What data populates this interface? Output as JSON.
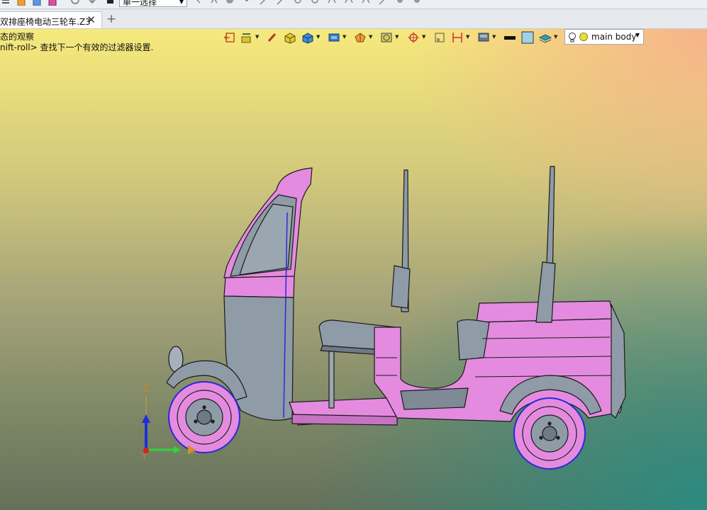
{
  "toolbar": {
    "selection_filter": "单一选择",
    "icons": [
      "menu-icon",
      "open-icon",
      "save-icon",
      "save-as-icon",
      "undo-icon",
      "redo-icon",
      "pick-point-icon",
      "line-icon",
      "circle-icon",
      "curve-icon"
    ]
  },
  "tabs": {
    "doc_title": "双排座椅电动三轮车.Z3",
    "close_glyph": "✕",
    "new_glyph": "+"
  },
  "messages": {
    "line1": "态的观察",
    "line2": "nift-roll> 查找下一个有效的过滤器设置."
  },
  "view_toolbar": {
    "layer_name": "main body",
    "buttons": [
      "exit-view-icon",
      "wireframe-icon",
      "pen-icon",
      "shaded-icon",
      "cube-view-icon",
      "view-cube-icon",
      "render-mode-icon",
      "section-icon",
      "target-icon",
      "box-icon",
      "align-icon",
      "display-icon",
      "line-color-icon",
      "fill-color-icon",
      "layer-stack-icon"
    ]
  },
  "triad": {
    "z_label": "Z",
    "y_label": "Y",
    "x_label": "X"
  },
  "colors": {
    "pink": "#e48be0",
    "grey": "#8f9ba6",
    "outline": "#1a1a1a",
    "accent_blue": "#2a2ad8"
  }
}
